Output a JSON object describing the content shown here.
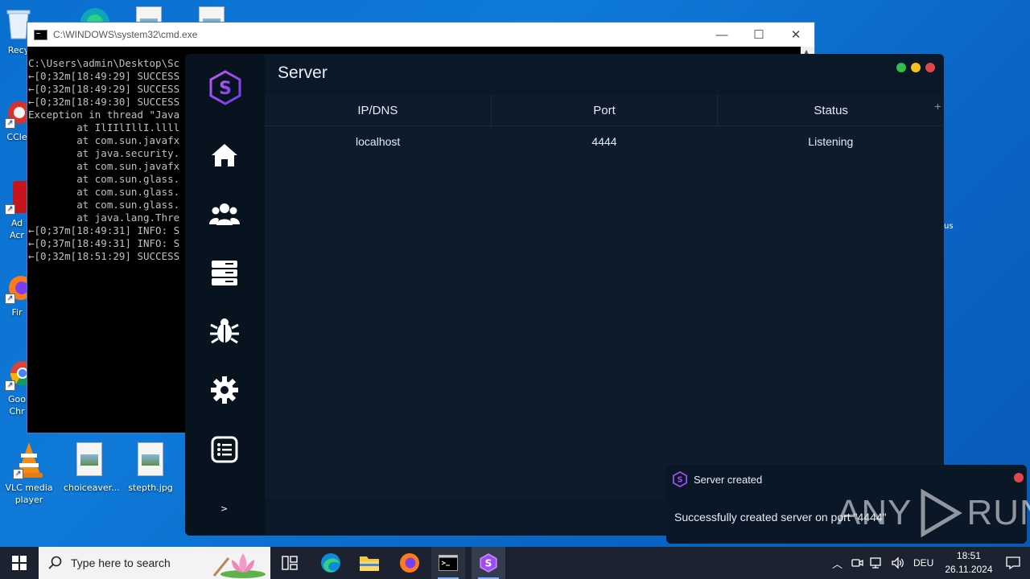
{
  "desktop": {
    "icons": [
      {
        "label": "Recy",
        "name": "recycle-bin"
      },
      {
        "label": "CCle",
        "name": "ccleaner"
      },
      {
        "label": "Ad\nAcr",
        "name": "adobe-acrobat"
      },
      {
        "label": "Fir",
        "name": "firefox"
      },
      {
        "label": "Goo\nChr",
        "name": "google-chrome"
      },
      {
        "label": "VLC media player",
        "name": "vlc-media-player"
      },
      {
        "label": "choiceaver...",
        "name": "choiceaver-file"
      },
      {
        "label": "stepth.jpg",
        "name": "stepth-file"
      }
    ],
    "edge_label_fragment": "us"
  },
  "cmd": {
    "title": "C:\\WINDOWS\\system32\\cmd.exe",
    "lines": "C:\\Users\\admin\\Desktop\\Sc\n←[0;32m[18:49:29] SUCCESS\n←[0;32m[18:49:29] SUCCESS\n←[0;32m[18:49:30] SUCCESS\nException in thread \"Java\n        at IlIIlIllI.llll\n        at com.sun.javafx\n        at java.security.\n        at com.sun.javafx\n        at com.sun.glass.\n        at com.sun.glass.\n        at com.sun.glass.\n        at java.lang.Thre\n←[0;37m[18:49:31] INFO: S\n←[0;37m[18:49:31] INFO: S\n←[0;32m[18:51:29] SUCCESS"
  },
  "app": {
    "title": "Server",
    "nav": [
      {
        "name": "home-icon"
      },
      {
        "name": "users-icon"
      },
      {
        "name": "servers-icon"
      },
      {
        "name": "bug-icon"
      },
      {
        "name": "settings-gear-icon"
      },
      {
        "name": "logs-list-icon"
      }
    ],
    "more": ">",
    "table": {
      "headers": [
        "IP/DNS",
        "Port",
        "Status"
      ],
      "rows": [
        [
          "localhost",
          "4444",
          "Listening"
        ]
      ],
      "add": "+"
    },
    "colors": {
      "accent": "#a04df0",
      "green": "#2dbf4a",
      "yellow": "#f5c21b",
      "red": "#e0474c"
    }
  },
  "toast": {
    "title": "Server created",
    "message": "Successfully created server on port \"4444\""
  },
  "watermark": {
    "left": "ANY",
    "right": "RUN"
  },
  "taskbar": {
    "search_placeholder": "Type here to search",
    "language": "DEU",
    "time": "18:51",
    "date": "26.11.2024"
  }
}
